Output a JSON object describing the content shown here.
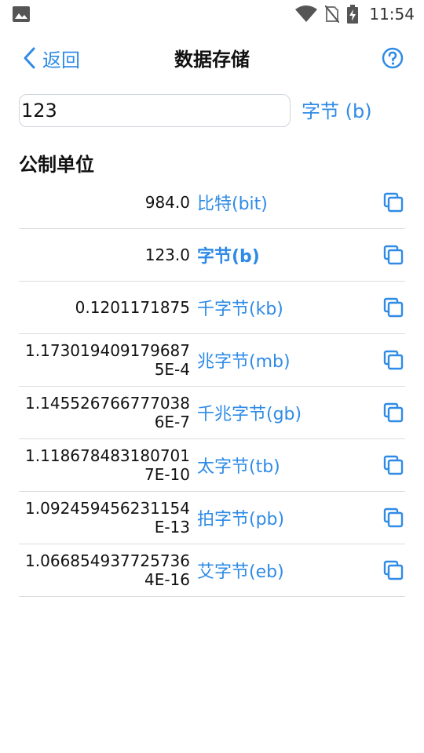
{
  "status_bar": {
    "time": "11:54",
    "icons": [
      "image-icon",
      "wifi-icon",
      "no-sim-icon",
      "battery-charging-icon"
    ]
  },
  "nav": {
    "back_label": "返回",
    "title": "数据存储",
    "help_icon": "help-circle-icon"
  },
  "input": {
    "value": "123",
    "unit_label": "字节 (b)"
  },
  "section": {
    "title": "公制单位"
  },
  "accent_color": "#2f8be6",
  "units": [
    {
      "value": "984.0",
      "label": "比特(bit)",
      "selected": false
    },
    {
      "value": "123.0",
      "label": "字节(b)",
      "selected": true
    },
    {
      "value": "0.1201171875",
      "label": "千字节(kb)",
      "selected": false
    },
    {
      "value": "1.1730194091796875E-4",
      "label": "兆字节(mb)",
      "selected": false
    },
    {
      "value": "1.1455267667770386E-7",
      "label": "千兆字节(gb)",
      "selected": false
    },
    {
      "value": "1.1186784831807017E-10",
      "label": "太字节(tb)",
      "selected": false
    },
    {
      "value": "1.092459456231154E-13",
      "label": "拍字节(pb)",
      "selected": false
    },
    {
      "value": "1.0668549377257364E-16",
      "label": "艾字节(eb)",
      "selected": false
    }
  ]
}
